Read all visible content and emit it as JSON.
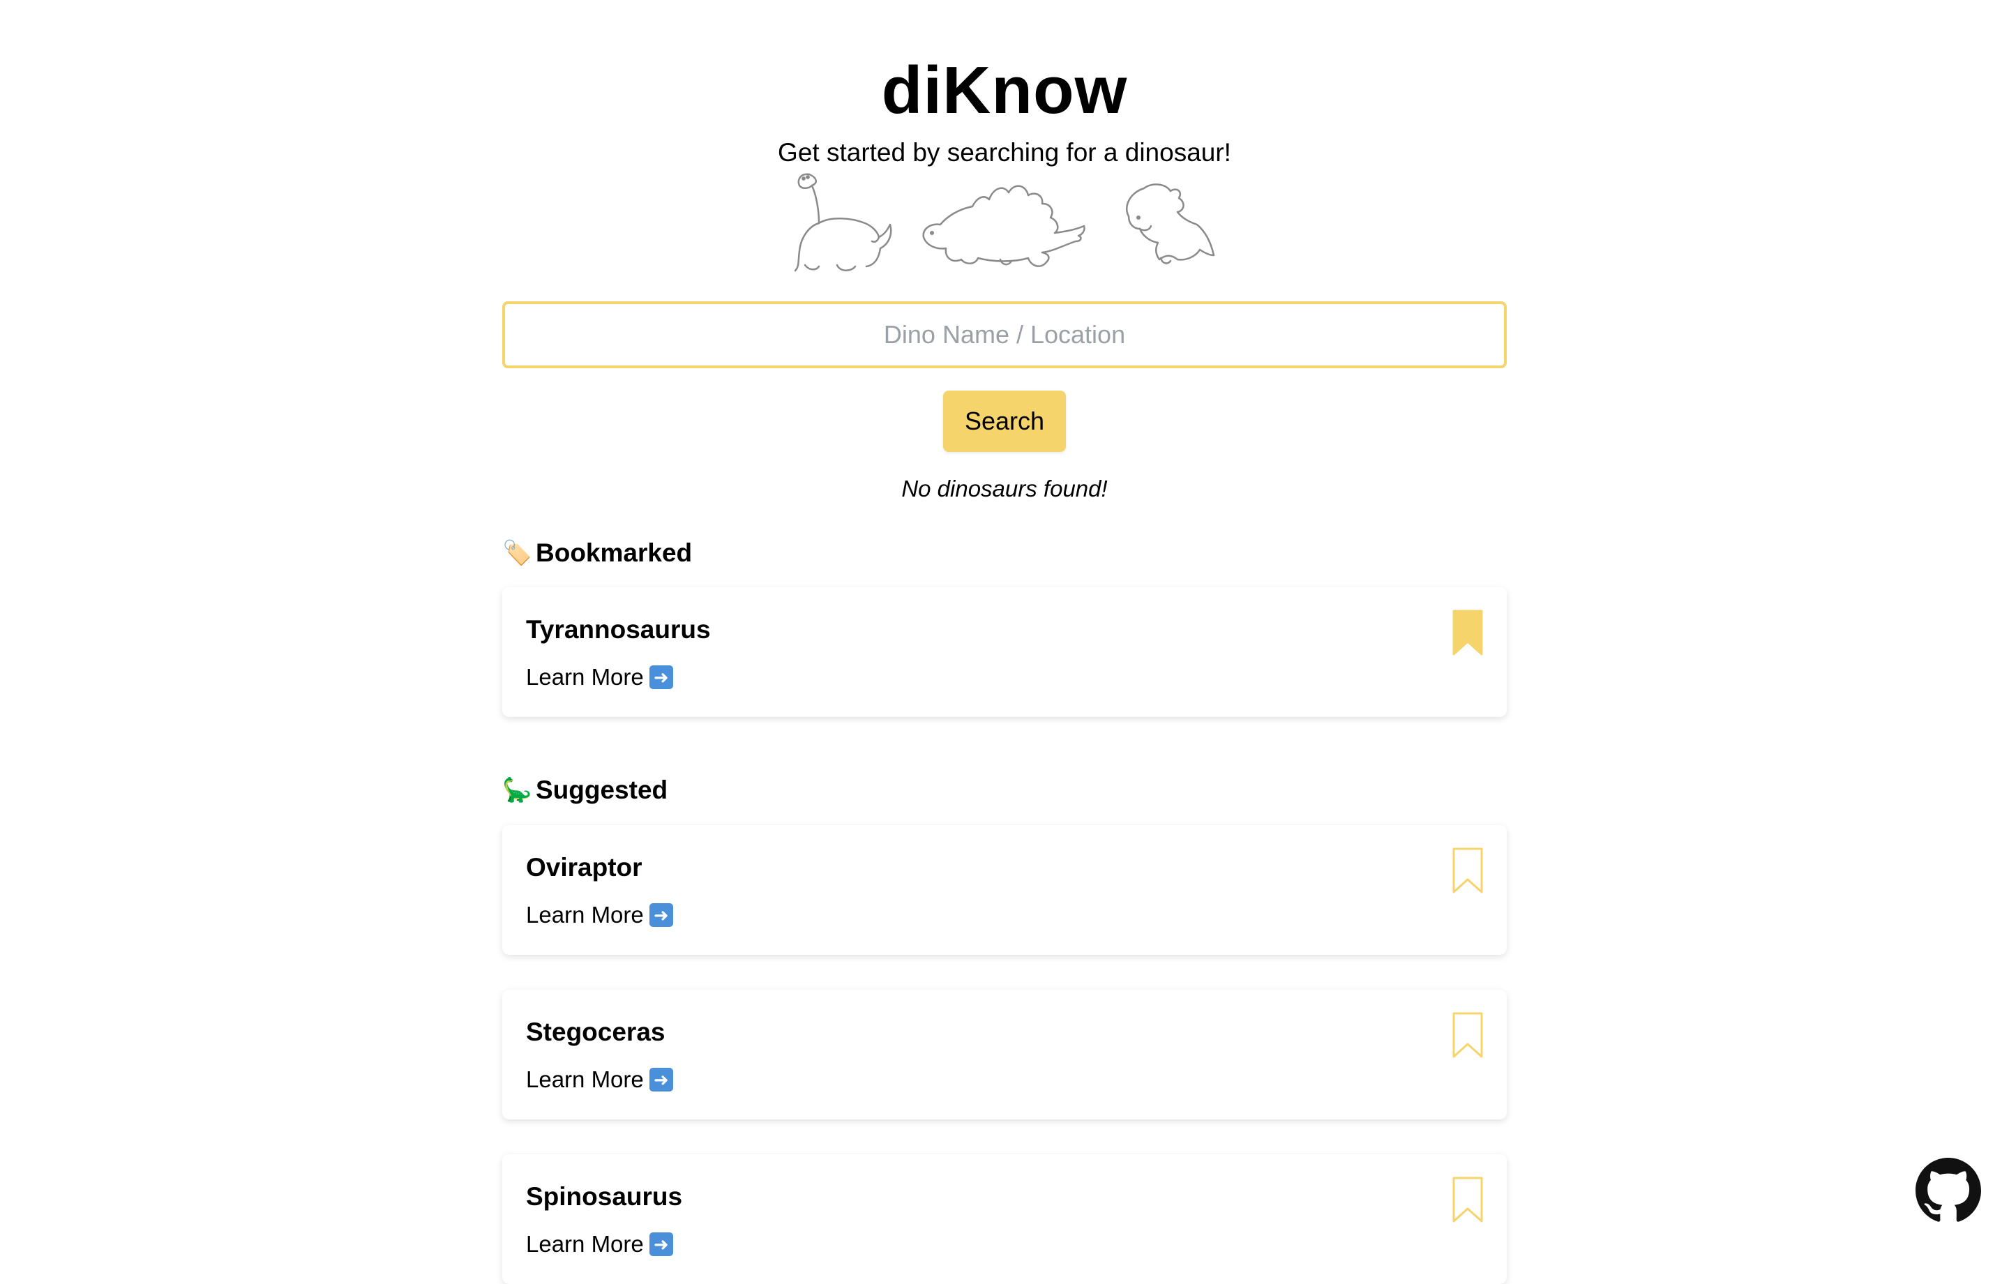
{
  "header": {
    "title": "diKnow",
    "tagline": "Get started by searching for a dinosaur!"
  },
  "search": {
    "placeholder": "Dino Name / Location",
    "value": "",
    "button_label": "Search"
  },
  "status": {
    "message": "No dinosaurs found!"
  },
  "bookmarked": {
    "heading": "Bookmarked",
    "heading_emoji": "🏷️",
    "items": [
      {
        "name": "Tyrannosaurus",
        "link_label": "Learn More",
        "bookmarked": true
      }
    ]
  },
  "suggested": {
    "heading": "Suggested",
    "heading_emoji": "🦕",
    "items": [
      {
        "name": "Oviraptor",
        "link_label": "Learn More",
        "bookmarked": false
      },
      {
        "name": "Stegoceras",
        "link_label": "Learn More",
        "bookmarked": false
      },
      {
        "name": "Spinosaurus",
        "link_label": "Learn More",
        "bookmarked": false
      }
    ]
  },
  "colors": {
    "accent": "#f6d46c",
    "bookmark": "#f6d46c",
    "link_arrow": "#4a8fd9"
  },
  "icons": {
    "arrow": "right-arrow-icon",
    "bookmark": "bookmark-icon",
    "github": "github-icon"
  }
}
